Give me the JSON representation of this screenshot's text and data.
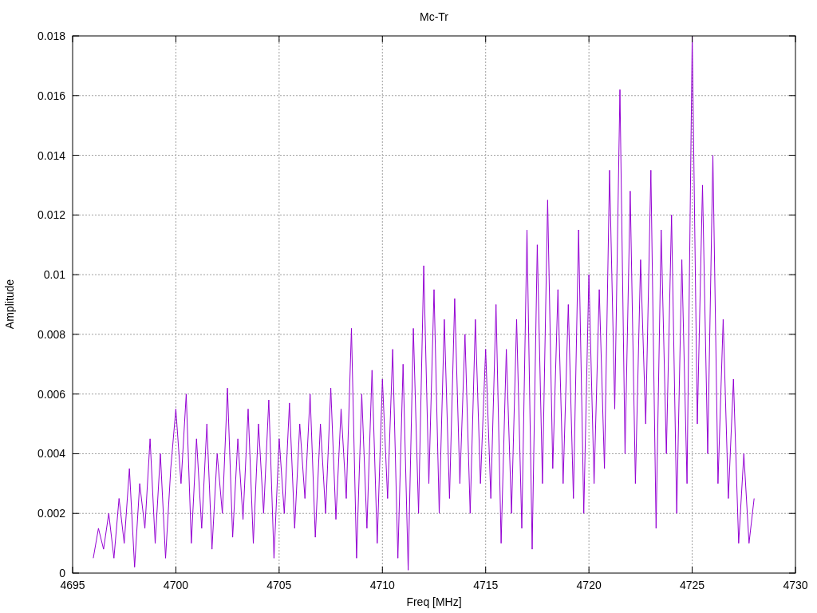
{
  "chart_data": {
    "type": "line",
    "title": "Mc-Tr",
    "xlabel": "Freq [MHz]",
    "ylabel": "Amplitude",
    "grid": true,
    "xlim": [
      4695,
      4730
    ],
    "ylim": [
      0,
      0.018
    ],
    "xticks": [
      4695,
      4700,
      4705,
      4710,
      4715,
      4720,
      4725,
      4730
    ],
    "yticks": [
      0,
      0.002,
      0.004,
      0.006,
      0.008,
      0.01,
      0.012,
      0.014,
      0.016,
      0.018
    ],
    "x": [
      4696,
      4696.25,
      4696.5,
      4696.75,
      4697,
      4697.25,
      4697.5,
      4697.75,
      4698,
      4698.25,
      4698.5,
      4698.75,
      4699,
      4699.25,
      4699.5,
      4699.75,
      4700,
      4700.25,
      4700.5,
      4700.75,
      4701,
      4701.25,
      4701.5,
      4701.75,
      4702,
      4702.25,
      4702.5,
      4702.75,
      4703,
      4703.25,
      4703.5,
      4703.75,
      4704,
      4704.25,
      4704.5,
      4704.75,
      4705,
      4705.25,
      4705.5,
      4705.75,
      4706,
      4706.25,
      4706.5,
      4706.75,
      4707,
      4707.25,
      4707.5,
      4707.75,
      4708,
      4708.25,
      4708.5,
      4708.75,
      4709,
      4709.25,
      4709.5,
      4709.75,
      4710,
      4710.25,
      4710.5,
      4710.75,
      4711,
      4711.25,
      4711.5,
      4711.75,
      4712,
      4712.25,
      4712.5,
      4712.75,
      4713,
      4713.25,
      4713.5,
      4713.75,
      4714,
      4714.25,
      4714.5,
      4714.75,
      4715,
      4715.25,
      4715.5,
      4715.75,
      4716,
      4716.25,
      4716.5,
      4716.75,
      4717,
      4717.25,
      4717.5,
      4717.75,
      4718,
      4718.25,
      4718.5,
      4718.75,
      4719,
      4719.25,
      4719.5,
      4719.75,
      4720,
      4720.25,
      4720.5,
      4720.75,
      4721,
      4721.25,
      4721.5,
      4721.75,
      4722,
      4722.25,
      4722.5,
      4722.75,
      4723,
      4723.25,
      4723.5,
      4723.75,
      4724,
      4724.25,
      4724.5,
      4724.75,
      4725,
      4725.25,
      4725.5,
      4725.75,
      4726,
      4726.25,
      4726.5,
      4726.75,
      4727,
      4727.25,
      4727.5,
      4727.75,
      4728
    ],
    "series": [
      {
        "color": "#9400d3",
        "values": [
          0.0005,
          0.0015,
          0.0008,
          0.002,
          0.0005,
          0.0025,
          0.001,
          0.0035,
          0.0002,
          0.003,
          0.0015,
          0.0045,
          0.001,
          0.004,
          0.0005,
          0.0035,
          0.0055,
          0.003,
          0.006,
          0.001,
          0.0045,
          0.0015,
          0.005,
          0.0008,
          0.004,
          0.002,
          0.0062,
          0.0012,
          0.0045,
          0.0018,
          0.0055,
          0.001,
          0.005,
          0.002,
          0.0058,
          0.0005,
          0.0045,
          0.002,
          0.0057,
          0.0015,
          0.005,
          0.0025,
          0.006,
          0.0012,
          0.005,
          0.002,
          0.0062,
          0.0018,
          0.0055,
          0.0025,
          0.0082,
          0.0005,
          0.006,
          0.0015,
          0.0068,
          0.001,
          0.0065,
          0.0025,
          0.0075,
          0.0005,
          0.007,
          0.0001,
          0.0082,
          0.002,
          0.0103,
          0.003,
          0.0095,
          0.002,
          0.0085,
          0.0025,
          0.0092,
          0.003,
          0.008,
          0.002,
          0.0085,
          0.003,
          0.0075,
          0.0025,
          0.009,
          0.001,
          0.0075,
          0.002,
          0.0085,
          0.0015,
          0.0115,
          0.0008,
          0.011,
          0.003,
          0.0125,
          0.0035,
          0.0095,
          0.003,
          0.009,
          0.0025,
          0.0115,
          0.002,
          0.01,
          0.003,
          0.0095,
          0.0035,
          0.0135,
          0.0055,
          0.0162,
          0.004,
          0.0128,
          0.003,
          0.0105,
          0.005,
          0.0135,
          0.0015,
          0.0115,
          0.004,
          0.012,
          0.002,
          0.0105,
          0.003,
          0.018,
          0.005,
          0.013,
          0.004,
          0.014,
          0.003,
          0.0085,
          0.0025,
          0.0065,
          0.001,
          0.004,
          0.001,
          0.0025
        ]
      }
    ]
  }
}
